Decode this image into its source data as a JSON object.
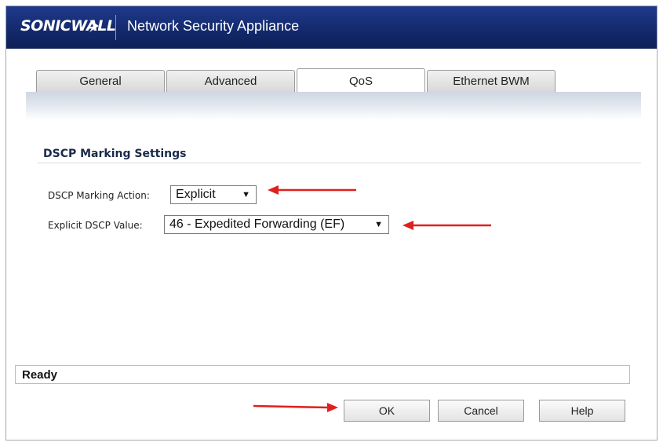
{
  "header": {
    "logo_text": "SONICWALL",
    "title": "Network Security Appliance"
  },
  "tabs": [
    {
      "label": "General",
      "active": false
    },
    {
      "label": "Advanced",
      "active": false
    },
    {
      "label": "QoS",
      "active": true
    },
    {
      "label": "Ethernet BWM",
      "active": false
    }
  ],
  "section": {
    "title": "DSCP Marking Settings"
  },
  "fields": {
    "marking_action": {
      "label": "DSCP Marking Action:",
      "value": "Explicit"
    },
    "explicit_value": {
      "label": "Explicit DSCP Value:",
      "value": "46 - Expedited Forwarding (EF)"
    }
  },
  "status": {
    "text": "Ready"
  },
  "buttons": {
    "ok": "OK",
    "cancel": "Cancel",
    "help": "Help"
  },
  "colors": {
    "header_bg": "#142a6e",
    "annotation_arrow": "#e0201c"
  },
  "icons": {
    "dropdown_caret": "▼"
  }
}
